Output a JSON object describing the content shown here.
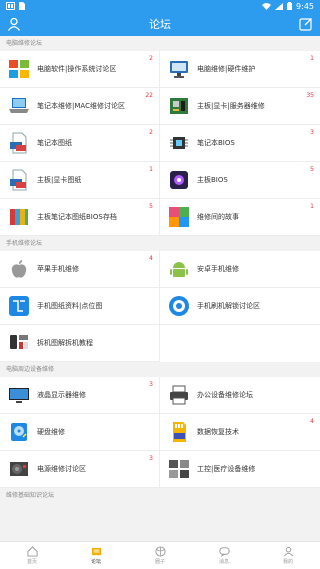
{
  "status": {
    "time": "9:45"
  },
  "header": {
    "title": "论坛"
  },
  "sections": [
    {
      "title": "电脑维修论坛",
      "items": [
        {
          "label": "电脑软件|操作系统讨论区",
          "badge": "2",
          "icon": "windows-logo-icon"
        },
        {
          "label": "电脑维修|硬件维护",
          "badge": "1",
          "icon": "monitor-icon"
        },
        {
          "label": "笔记本维修|MAC维修讨论区",
          "badge": "22",
          "icon": "laptop-icon"
        },
        {
          "label": "主板|显卡|服务器维修",
          "badge": "35",
          "icon": "motherboard-icon"
        },
        {
          "label": "笔记本图纸",
          "badge": "2",
          "icon": "pdf-file-icon"
        },
        {
          "label": "笔记本BIOS",
          "badge": "3",
          "icon": "chip-icon"
        },
        {
          "label": "主板|显卡图纸",
          "badge": "1",
          "icon": "pdf-file-icon"
        },
        {
          "label": "主板BIOS",
          "badge": "5",
          "icon": "bios-chip-icon"
        },
        {
          "label": "主板笔记本图纸BIOS存档",
          "badge": "5",
          "icon": "archive-books-icon"
        },
        {
          "label": "维修间的故事",
          "badge": "1",
          "icon": "story-tiles-icon"
        }
      ]
    },
    {
      "title": "手机维修论坛",
      "items": [
        {
          "label": "苹果手机维修",
          "badge": "4",
          "icon": "apple-logo-icon"
        },
        {
          "label": "安卓手机维修",
          "badge": "",
          "icon": "android-logo-icon"
        },
        {
          "label": "手机图纸资料|点位图",
          "badge": "",
          "icon": "schematic-icon"
        },
        {
          "label": "手机刷机解锁讨论区",
          "badge": "",
          "icon": "unlock-circle-icon"
        },
        {
          "label": "拆机图解拆机教程",
          "badge": "",
          "icon": "teardown-parts-icon"
        }
      ]
    },
    {
      "title": "电脑周边设备维修",
      "items": [
        {
          "label": "液晶显示器维修",
          "badge": "3",
          "icon": "lcd-monitor-icon"
        },
        {
          "label": "办公设备维修论坛",
          "badge": "",
          "icon": "printer-icon"
        },
        {
          "label": "硬盘维修",
          "badge": "",
          "icon": "hard-disk-icon"
        },
        {
          "label": "数据恢复技术",
          "badge": "4",
          "icon": "sd-card-icon"
        },
        {
          "label": "电源维修讨论区",
          "badge": "3",
          "icon": "power-supply-icon"
        },
        {
          "label": "工控|医疗设备维修",
          "badge": "",
          "icon": "industrial-devices-icon"
        }
      ]
    },
    {
      "title": "维修基础知识论坛",
      "items": []
    }
  ],
  "tabs": [
    {
      "label": "首页",
      "icon": "home-icon",
      "active": false
    },
    {
      "label": "论坛",
      "icon": "forum-icon",
      "active": true
    },
    {
      "label": "圈子",
      "icon": "circle-icon",
      "active": false
    },
    {
      "label": "消息",
      "icon": "message-icon",
      "active": false
    },
    {
      "label": "我的",
      "icon": "user-icon",
      "active": false
    }
  ],
  "colors": {
    "primary": "#2d9cef",
    "badge": "#e33333"
  }
}
